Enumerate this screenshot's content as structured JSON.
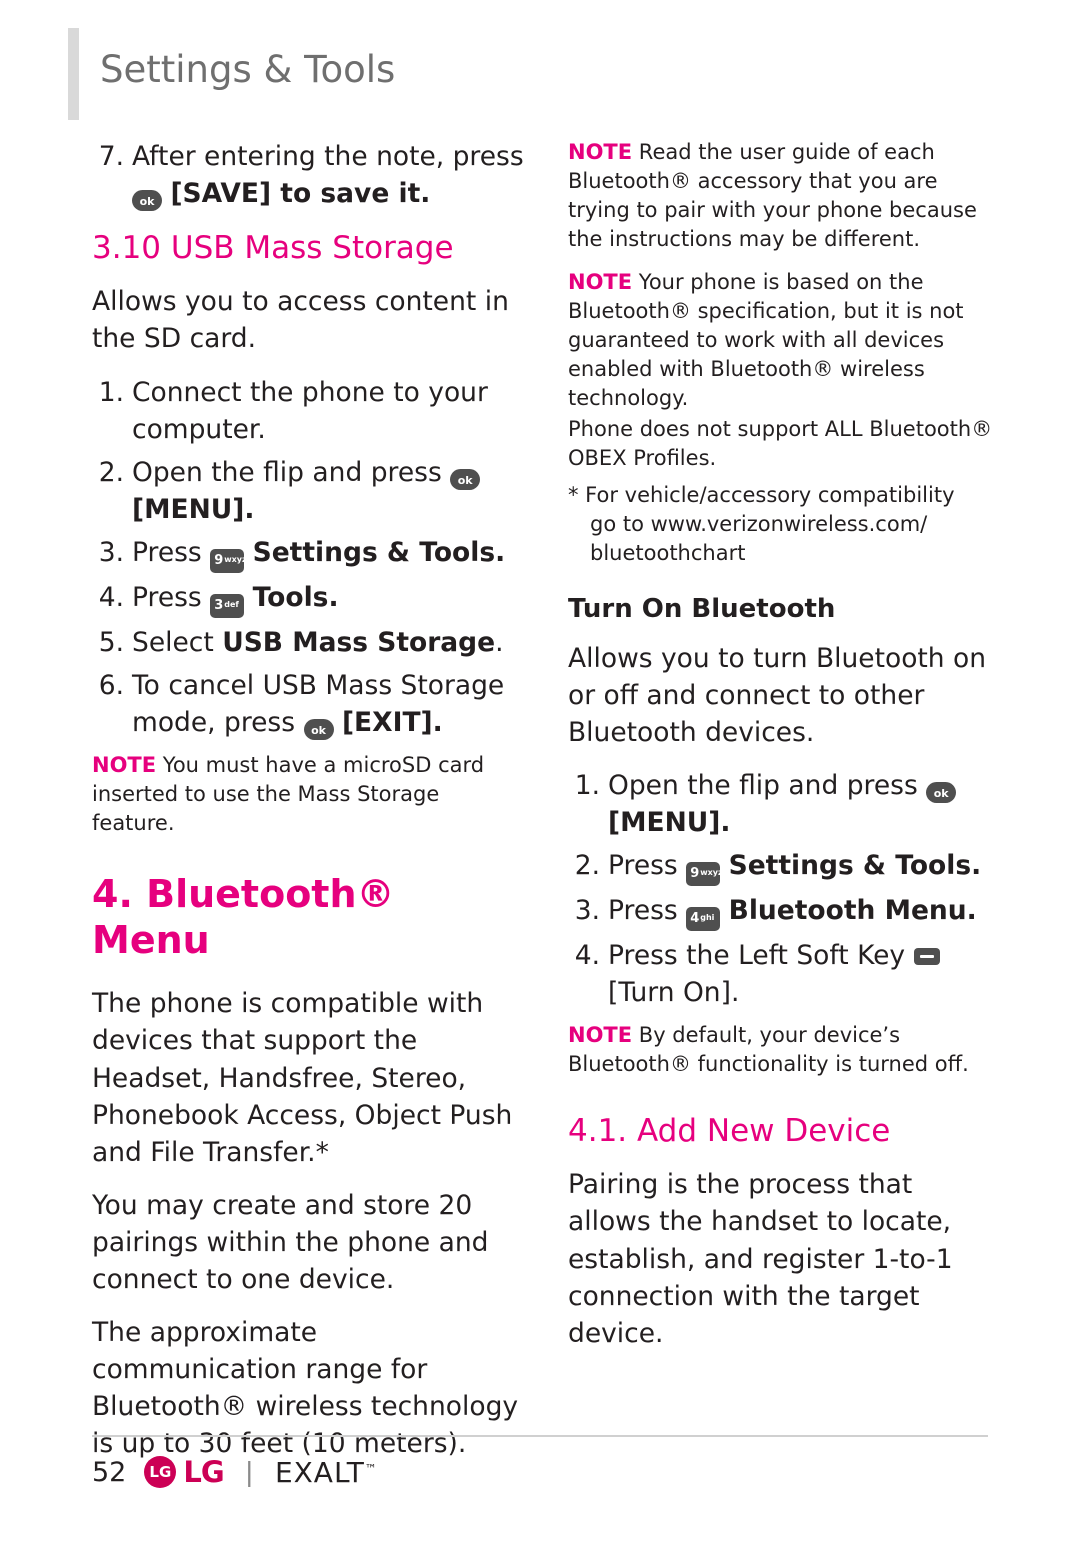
{
  "header": {
    "title": "Settings & Tools"
  },
  "left_column": {
    "step7": {
      "num": "7.",
      "text_before": "After entering the note, press",
      "key": "ok",
      "text_after": "[SAVE] to save it."
    },
    "usb_heading": "3.10 USB Mass Storage",
    "usb_intro": "Allows you to access content in the SD card.",
    "usb_steps": [
      {
        "num": "1.",
        "text": "Connect the phone to your computer."
      },
      {
        "num": "2.",
        "text_before": "Open the flip and press",
        "key": "ok",
        "text_after": "[MENU]."
      },
      {
        "num": "3.",
        "text_before": "Press",
        "key": "9wxyz",
        "text_after": "Settings & Tools."
      },
      {
        "num": "4.",
        "text_before": "Press",
        "key": "3def",
        "text_after": "Tools."
      },
      {
        "num": "5.",
        "text_before": "Select",
        "text_bold": "USB Mass Storage",
        "text_after": "."
      },
      {
        "num": "6.",
        "text_before": "To cancel USB Mass Storage mode, press",
        "key": "ok",
        "text_after": "[EXIT]."
      }
    ],
    "usb_note": {
      "label": "NOTE",
      "text": "You must have a microSD card inserted to use the Mass Storage feature."
    },
    "bluetooth_heading": "4. Bluetooth® Menu",
    "bluetooth_p1": "The phone is compatible with devices that support the Headset, Handsfree, Stereo, Phonebook Access, Object Push and File Transfer.*",
    "bluetooth_p2": "You may create and store 20 pairings within the phone and connect to one device.",
    "bluetooth_p3": "The approximate communication range for Bluetooth® wireless technology is up to 30 feet (10 meters)."
  },
  "right_column": {
    "note1": {
      "label": "NOTE",
      "text": "Read the user guide of each Bluetooth® accessory that you are trying to pair with your phone because the instructions may be different."
    },
    "note2": {
      "label": "NOTE",
      "text": "Your phone is based on the Bluetooth® specification, but it is not guaranteed to work with all devices enabled with Bluetooth® wireless technology.",
      "extra": "Phone does not support ALL Bluetooth® OBEX Profiles.",
      "footnote_line1": "* For vehicle/accessory compatibility",
      "footnote_line2": "go to www.verizonwireless.com/",
      "footnote_line3": "bluetoothchart"
    },
    "turn_on_heading": "Turn On Bluetooth",
    "turn_on_intro": "Allows you to turn Bluetooth on or off and connect to other Bluetooth devices.",
    "turn_on_steps": [
      {
        "num": "1.",
        "text_before": "Open the flip and press",
        "key": "ok",
        "text_after": "[MENU]."
      },
      {
        "num": "2.",
        "text_before": "Press",
        "key": "9wxyz",
        "text_after": "Settings & Tools."
      },
      {
        "num": "3.",
        "text_before": "Press",
        "key": "4ghi",
        "text_after": "Bluetooth Menu."
      },
      {
        "num": "4.",
        "text_before": "Press the Left Soft Key",
        "key": "soft",
        "text_after": "[Turn On]."
      }
    ],
    "turn_on_note": {
      "label": "NOTE",
      "text": "By default, your device’s Bluetooth® functionality is turned off."
    },
    "add_device_heading": "4.1. Add New Device",
    "add_device_p1": "Pairing is the process that allows the handset to locate, establish, and register 1-to-1 connection with the target device."
  },
  "footer": {
    "page_number": "52",
    "brand_mark": "LG",
    "brand_text": "LG",
    "divider": "|",
    "model": "EXALT",
    "tm": "™"
  },
  "keys": {
    "ok": "ok",
    "nine": "9",
    "nine_sub": "wxyz",
    "three": "3",
    "three_sub": "def",
    "four": "4",
    "four_sub": "ghi"
  },
  "colors": {
    "accent_pink": "#e6007e",
    "header_gray": "#6f6f6f",
    "body": "#231f20"
  }
}
